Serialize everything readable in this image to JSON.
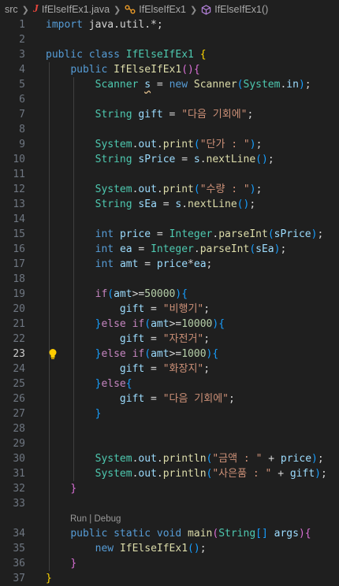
{
  "breadcrumb": {
    "folder": "src",
    "file": "IfElseIfEx1.java",
    "class": "IfElseIfEx1",
    "method": "IfElseIfEx1()"
  },
  "editor": {
    "active_line": 23,
    "codelens": {
      "run": "Run",
      "separator": "|",
      "debug": "Debug"
    },
    "lines": [
      {
        "n": "1",
        "tokens": [
          [
            "kw",
            "import"
          ],
          [
            "pl",
            " java.util.*;"
          ]
        ]
      },
      {
        "n": "2",
        "tokens": []
      },
      {
        "n": "3",
        "tokens": [
          [
            "kw",
            "public"
          ],
          [
            "pl",
            " "
          ],
          [
            "kw",
            "class"
          ],
          [
            "pl",
            " "
          ],
          [
            "ty",
            "IfElseIfEx1"
          ],
          [
            "pl",
            " "
          ],
          [
            "br1",
            "{"
          ]
        ]
      },
      {
        "n": "4",
        "tokens": [
          [
            "pl",
            "    "
          ],
          [
            "kw",
            "public"
          ],
          [
            "pl",
            " "
          ],
          [
            "fn",
            "IfElseIfEx1"
          ],
          [
            "br2",
            "()"
          ],
          [
            "br2",
            "{"
          ]
        ]
      },
      {
        "n": "5",
        "tokens": [
          [
            "pl",
            "        "
          ],
          [
            "ty",
            "Scanner"
          ],
          [
            "pl",
            " "
          ],
          [
            "var squig",
            "s"
          ],
          [
            "pl",
            " = "
          ],
          [
            "kw",
            "new"
          ],
          [
            "pl",
            " "
          ],
          [
            "fn",
            "Scanner"
          ],
          [
            "br3",
            "("
          ],
          [
            "ty",
            "System"
          ],
          [
            "pl",
            "."
          ],
          [
            "var",
            "in"
          ],
          [
            "br3",
            ")"
          ],
          [
            "pl",
            ";"
          ]
        ]
      },
      {
        "n": "6",
        "tokens": []
      },
      {
        "n": "7",
        "tokens": [
          [
            "pl",
            "        "
          ],
          [
            "ty",
            "String"
          ],
          [
            "pl",
            " "
          ],
          [
            "var",
            "gift"
          ],
          [
            "pl",
            " = "
          ],
          [
            "str",
            "\"다음 기회에\""
          ],
          [
            "pl",
            ";"
          ]
        ]
      },
      {
        "n": "8",
        "tokens": []
      },
      {
        "n": "9",
        "tokens": [
          [
            "pl",
            "        "
          ],
          [
            "ty",
            "System"
          ],
          [
            "pl",
            "."
          ],
          [
            "var",
            "out"
          ],
          [
            "pl",
            "."
          ],
          [
            "fn",
            "print"
          ],
          [
            "br3",
            "("
          ],
          [
            "str",
            "\"단가 : \""
          ],
          [
            "br3",
            ")"
          ],
          [
            "pl",
            ";"
          ]
        ]
      },
      {
        "n": "10",
        "tokens": [
          [
            "pl",
            "        "
          ],
          [
            "ty",
            "String"
          ],
          [
            "pl",
            " "
          ],
          [
            "var",
            "sPrice"
          ],
          [
            "pl",
            " = "
          ],
          [
            "var",
            "s"
          ],
          [
            "pl",
            "."
          ],
          [
            "fn",
            "nextLine"
          ],
          [
            "br3",
            "()"
          ],
          [
            "pl",
            ";"
          ]
        ]
      },
      {
        "n": "11",
        "tokens": []
      },
      {
        "n": "12",
        "tokens": [
          [
            "pl",
            "        "
          ],
          [
            "ty",
            "System"
          ],
          [
            "pl",
            "."
          ],
          [
            "var",
            "out"
          ],
          [
            "pl",
            "."
          ],
          [
            "fn",
            "print"
          ],
          [
            "br3",
            "("
          ],
          [
            "str",
            "\"수량 : \""
          ],
          [
            "br3",
            ")"
          ],
          [
            "pl",
            ";"
          ]
        ]
      },
      {
        "n": "13",
        "tokens": [
          [
            "pl",
            "        "
          ],
          [
            "ty",
            "String"
          ],
          [
            "pl",
            " "
          ],
          [
            "var",
            "sEa"
          ],
          [
            "pl",
            " = "
          ],
          [
            "var",
            "s"
          ],
          [
            "pl",
            "."
          ],
          [
            "fn",
            "nextLine"
          ],
          [
            "br3",
            "()"
          ],
          [
            "pl",
            ";"
          ]
        ]
      },
      {
        "n": "14",
        "tokens": []
      },
      {
        "n": "15",
        "tokens": [
          [
            "pl",
            "        "
          ],
          [
            "kw",
            "int"
          ],
          [
            "pl",
            " "
          ],
          [
            "var",
            "price"
          ],
          [
            "pl",
            " = "
          ],
          [
            "ty",
            "Integer"
          ],
          [
            "pl",
            "."
          ],
          [
            "fn",
            "parseInt"
          ],
          [
            "br3",
            "("
          ],
          [
            "var",
            "sPrice"
          ],
          [
            "br3",
            ")"
          ],
          [
            "pl",
            ";"
          ]
        ]
      },
      {
        "n": "16",
        "tokens": [
          [
            "pl",
            "        "
          ],
          [
            "kw",
            "int"
          ],
          [
            "pl",
            " "
          ],
          [
            "var",
            "ea"
          ],
          [
            "pl",
            " = "
          ],
          [
            "ty",
            "Integer"
          ],
          [
            "pl",
            "."
          ],
          [
            "fn",
            "parseInt"
          ],
          [
            "br3",
            "("
          ],
          [
            "var",
            "sEa"
          ],
          [
            "br3",
            ")"
          ],
          [
            "pl",
            ";"
          ]
        ]
      },
      {
        "n": "17",
        "tokens": [
          [
            "pl",
            "        "
          ],
          [
            "kw",
            "int"
          ],
          [
            "pl",
            " "
          ],
          [
            "var",
            "amt"
          ],
          [
            "pl",
            " = "
          ],
          [
            "var",
            "price"
          ],
          [
            "pl",
            "*"
          ],
          [
            "var",
            "ea"
          ],
          [
            "pl",
            ";"
          ]
        ]
      },
      {
        "n": "18",
        "tokens": []
      },
      {
        "n": "19",
        "tokens": [
          [
            "pl",
            "        "
          ],
          [
            "ctl",
            "if"
          ],
          [
            "br3",
            "("
          ],
          [
            "var",
            "amt"
          ],
          [
            "pl",
            ">="
          ],
          [
            "num",
            "50000"
          ],
          [
            "br3",
            ")"
          ],
          [
            "br3",
            "{"
          ]
        ]
      },
      {
        "n": "20",
        "tokens": [
          [
            "pl",
            "            "
          ],
          [
            "var",
            "gift"
          ],
          [
            "pl",
            " = "
          ],
          [
            "str",
            "\"비행기\""
          ],
          [
            "pl",
            ";"
          ]
        ]
      },
      {
        "n": "21",
        "tokens": [
          [
            "pl",
            "        "
          ],
          [
            "br3",
            "}"
          ],
          [
            "ctl",
            "else"
          ],
          [
            "pl",
            " "
          ],
          [
            "ctl",
            "if"
          ],
          [
            "br3",
            "("
          ],
          [
            "var",
            "amt"
          ],
          [
            "pl",
            ">="
          ],
          [
            "num",
            "10000"
          ],
          [
            "br3",
            ")"
          ],
          [
            "br3",
            "{"
          ]
        ]
      },
      {
        "n": "22",
        "tokens": [
          [
            "pl",
            "            "
          ],
          [
            "var",
            "gift"
          ],
          [
            "pl",
            " = "
          ],
          [
            "str",
            "\"자전거\""
          ],
          [
            "pl",
            ";"
          ]
        ]
      },
      {
        "n": "23",
        "tokens": [
          [
            "pl",
            "        "
          ],
          [
            "br3",
            "}"
          ],
          [
            "ctl",
            "else"
          ],
          [
            "pl",
            " "
          ],
          [
            "ctl",
            "if"
          ],
          [
            "br3",
            "("
          ],
          [
            "var",
            "amt"
          ],
          [
            "pl",
            ">="
          ],
          [
            "num",
            "1000"
          ],
          [
            "br3",
            ")"
          ],
          [
            "br3",
            "{"
          ]
        ]
      },
      {
        "n": "24",
        "tokens": [
          [
            "pl",
            "            "
          ],
          [
            "var",
            "gift"
          ],
          [
            "pl",
            " = "
          ],
          [
            "str",
            "\"화장지\""
          ],
          [
            "pl",
            ";"
          ]
        ]
      },
      {
        "n": "25",
        "tokens": [
          [
            "pl",
            "        "
          ],
          [
            "br3",
            "}"
          ],
          [
            "ctl",
            "else"
          ],
          [
            "br3",
            "{"
          ]
        ]
      },
      {
        "n": "26",
        "tokens": [
          [
            "pl",
            "            "
          ],
          [
            "var",
            "gift"
          ],
          [
            "pl",
            " = "
          ],
          [
            "str",
            "\"다음 기회에\""
          ],
          [
            "pl",
            ";"
          ]
        ]
      },
      {
        "n": "27",
        "tokens": [
          [
            "pl",
            "        "
          ],
          [
            "br3",
            "}"
          ]
        ]
      },
      {
        "n": "28",
        "tokens": []
      },
      {
        "n": "29",
        "tokens": []
      },
      {
        "n": "30",
        "tokens": [
          [
            "pl",
            "        "
          ],
          [
            "ty",
            "System"
          ],
          [
            "pl",
            "."
          ],
          [
            "var",
            "out"
          ],
          [
            "pl",
            "."
          ],
          [
            "fn",
            "println"
          ],
          [
            "br3",
            "("
          ],
          [
            "str",
            "\"금액 : \""
          ],
          [
            "pl",
            " + "
          ],
          [
            "var",
            "price"
          ],
          [
            "br3",
            ")"
          ],
          [
            "pl",
            ";"
          ]
        ]
      },
      {
        "n": "31",
        "tokens": [
          [
            "pl",
            "        "
          ],
          [
            "ty",
            "System"
          ],
          [
            "pl",
            "."
          ],
          [
            "var",
            "out"
          ],
          [
            "pl",
            "."
          ],
          [
            "fn",
            "println"
          ],
          [
            "br3",
            "("
          ],
          [
            "str",
            "\"사은품 : \""
          ],
          [
            "pl",
            " + "
          ],
          [
            "var",
            "gift"
          ],
          [
            "br3",
            ")"
          ],
          [
            "pl",
            ";"
          ]
        ]
      },
      {
        "n": "32",
        "tokens": [
          [
            "pl",
            "    "
          ],
          [
            "br2",
            "}"
          ]
        ]
      },
      {
        "n": "33",
        "tokens": []
      },
      {
        "n": "",
        "codelens": true,
        "tokens": []
      },
      {
        "n": "34",
        "tokens": [
          [
            "pl",
            "    "
          ],
          [
            "kw",
            "public"
          ],
          [
            "pl",
            " "
          ],
          [
            "kw",
            "static"
          ],
          [
            "pl",
            " "
          ],
          [
            "kw",
            "void"
          ],
          [
            "pl",
            " "
          ],
          [
            "fn",
            "main"
          ],
          [
            "br2",
            "("
          ],
          [
            "ty",
            "String"
          ],
          [
            "br3",
            "[]"
          ],
          [
            "pl",
            " "
          ],
          [
            "var",
            "args"
          ],
          [
            "br2",
            ")"
          ],
          [
            "br2",
            "{"
          ]
        ]
      },
      {
        "n": "35",
        "tokens": [
          [
            "pl",
            "        "
          ],
          [
            "kw",
            "new"
          ],
          [
            "pl",
            " "
          ],
          [
            "fn",
            "IfElseIfEx1"
          ],
          [
            "br3",
            "()"
          ],
          [
            "pl",
            ";"
          ]
        ]
      },
      {
        "n": "36",
        "tokens": [
          [
            "pl",
            "    "
          ],
          [
            "br2",
            "}"
          ]
        ]
      },
      {
        "n": "37",
        "tokens": [
          [
            "br1",
            "}"
          ]
        ]
      }
    ]
  }
}
